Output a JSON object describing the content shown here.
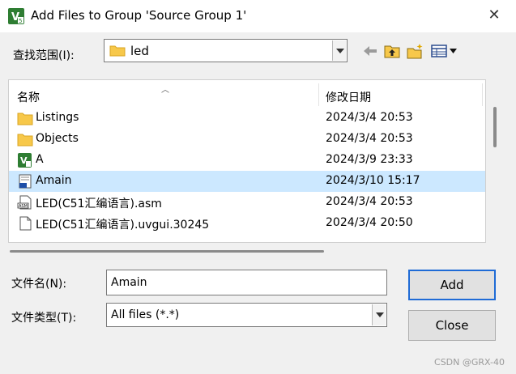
{
  "window": {
    "title": "Add Files to Group 'Source Group 1'",
    "close_glyph": "✕"
  },
  "lookin": {
    "label": "查找范围(I):",
    "value": "led"
  },
  "toolbar": [
    "back-icon",
    "up-folder-icon",
    "new-folder-icon",
    "view-menu-icon"
  ],
  "list": {
    "headers": {
      "name": "名称",
      "date": "修改日期"
    },
    "rows": [
      {
        "name": "Listings",
        "date": "2024/3/4 20:53",
        "icon": "folder-icon",
        "selected": false
      },
      {
        "name": "Objects",
        "date": "2024/3/4 20:53",
        "icon": "folder-icon",
        "selected": false
      },
      {
        "name": "A",
        "date": "2024/3/9 23:33",
        "icon": "uvision-project-icon",
        "selected": false
      },
      {
        "name": "Amain",
        "date": "2024/3/10 15:17",
        "icon": "file-icon",
        "selected": true
      },
      {
        "name": "LED(C51汇编语言).asm",
        "date": "2024/3/4 20:53",
        "icon": "asm-file-icon",
        "selected": false
      },
      {
        "name": "LED(C51汇编语言).uvgui.30245",
        "date": "2024/3/4 20:50",
        "icon": "file-icon",
        "selected": false
      }
    ]
  },
  "filename": {
    "label": "文件名(N):",
    "value": "Amain"
  },
  "filetype": {
    "label": "文件类型(T):",
    "value": "All files (*.*)"
  },
  "buttons": {
    "add": "Add",
    "close": "Close"
  },
  "watermark": "CSDN @GRX-40",
  "colors": {
    "selection": "#cce8ff",
    "folder": "#f7c84a",
    "default_button_border": "#1f6bd6",
    "app_icon": "#2e7d32"
  }
}
